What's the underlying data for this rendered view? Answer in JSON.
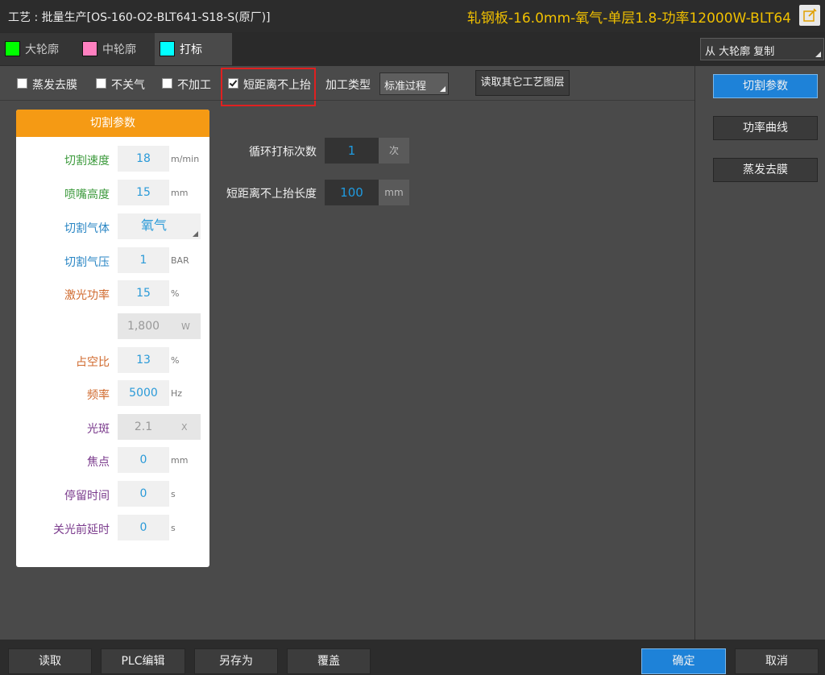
{
  "title": {
    "left": "工艺 : 批量生产[OS-160-O2-BLT641-S18-S(原厂)]",
    "right": "轧钢板-16.0mm-氧气-单层1.8-功率12000W-BLT64"
  },
  "tabs": [
    {
      "label": "大轮廓",
      "color": "#00ff00"
    },
    {
      "label": "中轮廓",
      "color": "#ff80c0"
    },
    {
      "label": "打标",
      "color": "#00ffff"
    }
  ],
  "copy_from": "从 大轮廓 复制",
  "options": {
    "evaporate": "蒸发去膜",
    "no_gas_off": "不关气",
    "no_process": "不加工",
    "short_no_lift": "短距离不上抬"
  },
  "process_type": {
    "label": "加工类型",
    "value": "标准过程"
  },
  "read_layer_button": "读取其它工艺图层",
  "side_buttons": [
    "切割参数",
    "功率曲线",
    "蒸发去膜"
  ],
  "card": {
    "header": "切割参数",
    "rows": {
      "speed": {
        "label": "切割速度",
        "value": "18",
        "unit": "m/min",
        "color": "#3c9a3c"
      },
      "nozzle_height": {
        "label": "喷嘴高度",
        "value": "15",
        "unit": "mm",
        "color": "#3c9a3c"
      },
      "gas": {
        "label": "切割气体",
        "value": "氧气",
        "color": "#2a86c4"
      },
      "gas_pressure": {
        "label": "切割气压",
        "value": "1",
        "unit": "BAR",
        "color": "#2a86c4"
      },
      "laser_power": {
        "label": "激光功率",
        "value": "15",
        "unit": "%",
        "color": "#d06a2e"
      },
      "power_w": {
        "value": "1,800",
        "unit": "W"
      },
      "duty": {
        "label": "占空比",
        "value": "13",
        "unit": "%",
        "color": "#d06a2e"
      },
      "frequency": {
        "label": "频率",
        "value": "5000",
        "unit": "Hz",
        "color": "#d06a2e"
      },
      "spot": {
        "label": "光斑",
        "value": "2.1",
        "unit": "X",
        "color": "#7a3a8c"
      },
      "focus": {
        "label": "焦点",
        "value": "0",
        "unit": "mm",
        "color": "#7a3a8c"
      },
      "dwell": {
        "label": "停留时间",
        "value": "0",
        "unit": "s",
        "color": "#7a3a8c"
      },
      "delay_before_off": {
        "label": "关光前延时",
        "value": "0",
        "unit": "s",
        "color": "#7a3a8c"
      }
    }
  },
  "marking": {
    "loop_count": {
      "label": "循环打标次数",
      "value": "1",
      "unit": "次"
    },
    "short_length": {
      "label": "短距离不上抬长度",
      "value": "100",
      "unit": "mm"
    }
  },
  "bottom_buttons": {
    "read": "读取",
    "plc_edit": "PLC编辑",
    "save_as": "另存为",
    "overwrite": "覆盖",
    "ok": "确定",
    "cancel": "取消"
  }
}
